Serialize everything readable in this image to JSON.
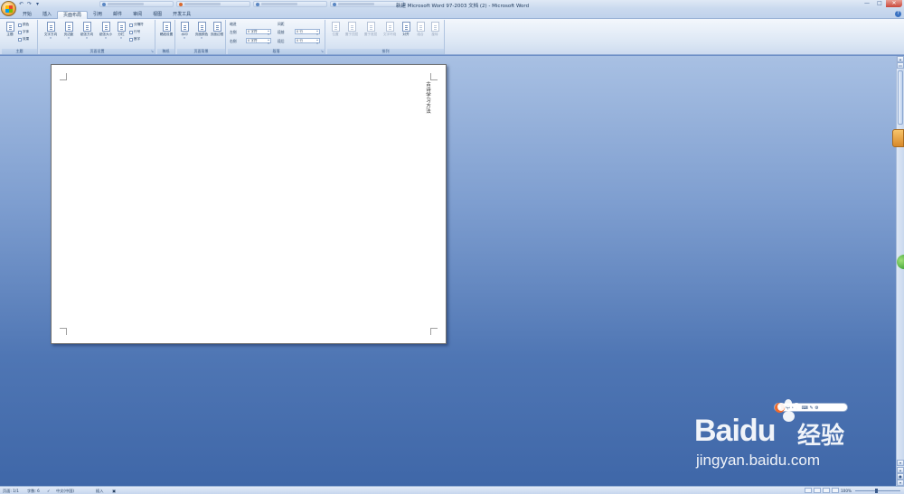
{
  "window": {
    "title": "新建 Microsoft Word 97-2003 文档 (2) - Microsoft Word",
    "minimize": "—",
    "maximize": "□",
    "close": "✕"
  },
  "quick_access": [
    "↶",
    "↷",
    "▾"
  ],
  "ribbon_tabs": [
    {
      "label": "开始"
    },
    {
      "label": "插入"
    },
    {
      "label": "页面布局"
    },
    {
      "label": "引用"
    },
    {
      "label": "邮件"
    },
    {
      "label": "审阅"
    },
    {
      "label": "视图"
    },
    {
      "label": "开发工具"
    }
  ],
  "active_tab": "页面布局",
  "ribbon": {
    "theme": {
      "label": "主题",
      "btn": "主题",
      "colors": "颜色",
      "fonts": "字体",
      "effects": "效果"
    },
    "page_setup": {
      "label": "页面设置",
      "text_direction": "文字方向",
      "margins": "页边距",
      "orientation": "纸张方向",
      "size": "纸张大小",
      "columns": "分栏",
      "breaks": "分隔符",
      "line_numbers": "行号",
      "hyphenation": "断字"
    },
    "draft": {
      "label": "稿纸",
      "btn": "稿纸设置"
    },
    "page_background": {
      "label": "页面背景",
      "watermark": "水印",
      "page_color": "页面颜色",
      "page_borders": "页面边框"
    },
    "paragraph": {
      "label": "段落",
      "indent": "缩进",
      "spacing": "间距",
      "left_label": "左侧",
      "right_label": "右侧",
      "before_label": "段前",
      "after_label": "段后",
      "left_value": "0 字符",
      "right_value": "0 字符",
      "before_value": "0 行",
      "after_value": "0 行"
    },
    "arrange": {
      "label": "排列",
      "position": "位置",
      "bring_front": "置于顶层",
      "send_back": "置于底层",
      "wrap": "文字环绕",
      "align": "对齐",
      "group": "组合",
      "rotate": "旋转"
    }
  },
  "document": {
    "vertical_text": "古诗学习方法"
  },
  "statusbar": {
    "page": "页面: 1/1",
    "words": "字数: 6",
    "language": "中文(中国)",
    "mode": "插入",
    "zoom": "100%"
  },
  "watermark": {
    "brand": "Bai",
    "brand2": "du",
    "jingyan": "经验",
    "url": "jingyan.baidu.com"
  },
  "ime": {
    "logo": "S",
    "items": "中 • 。 ⌨ ✎ ⚙"
  }
}
